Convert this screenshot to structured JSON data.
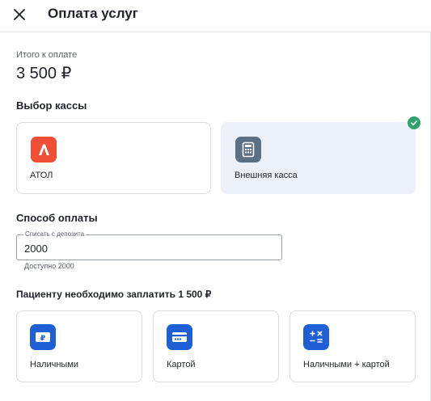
{
  "header": {
    "title": "Оплата услуг",
    "close_icon": "close-icon"
  },
  "total": {
    "label": "Итого к оплате",
    "amount": "3 500 ₽"
  },
  "cashbox": {
    "title": "Выбор кассы",
    "options": [
      {
        "label": "АТОЛ",
        "icon": "atol-logo-icon",
        "color": "#f04e37",
        "selected": false
      },
      {
        "label": "Внешняя касса",
        "icon": "cash-register-icon",
        "color": "#5b6f85",
        "selected": true
      }
    ]
  },
  "payment": {
    "title": "Способ оплаты",
    "deposit_field": {
      "label": "Списать с депозита",
      "value": "2000"
    },
    "helper": "Доступно 2000"
  },
  "remaining": {
    "title": "Пациенту необходимо заплатить 1 500 ₽",
    "methods": [
      {
        "label": "Наличными",
        "icon": "cash-icon"
      },
      {
        "label": "Картой",
        "icon": "card-icon"
      },
      {
        "label": "Наличными + картой",
        "icon": "calculator-icon"
      }
    ],
    "accent": "#1f5fd6"
  },
  "colors": {
    "selected_bg": "#ecf0f8",
    "check": "#2fa36b"
  }
}
